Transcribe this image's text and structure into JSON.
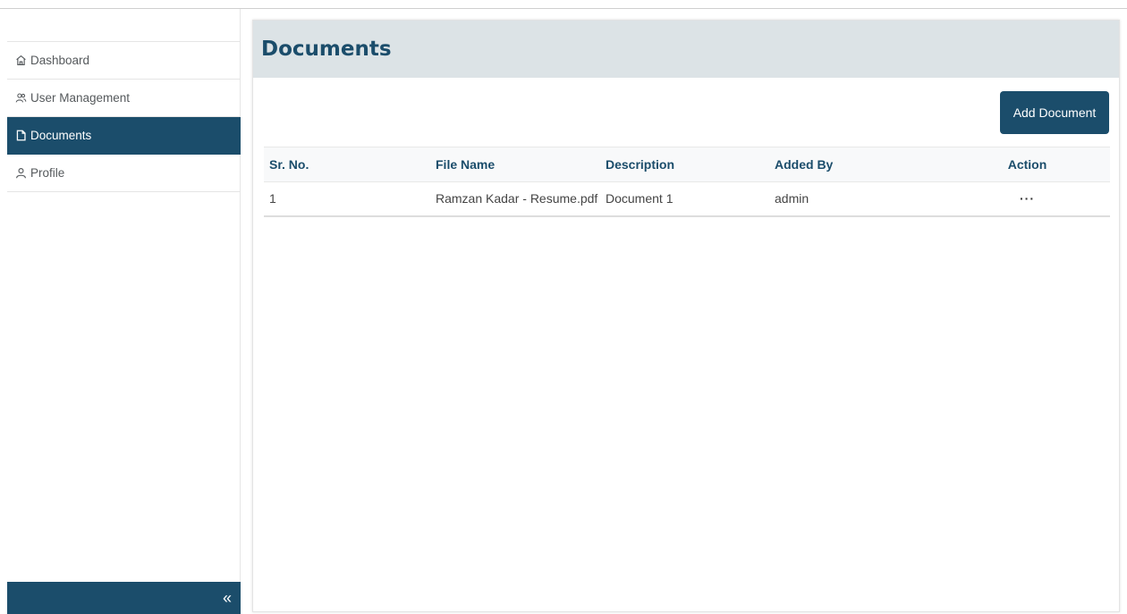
{
  "sidebar": {
    "items": [
      {
        "label": "Dashboard",
        "icon": "home-icon",
        "active": false
      },
      {
        "label": "User Management",
        "icon": "users-icon",
        "active": false
      },
      {
        "label": "Documents",
        "icon": "document-icon",
        "active": true
      },
      {
        "label": "Profile",
        "icon": "user-icon",
        "active": false
      }
    ],
    "collapse_label": "«"
  },
  "main": {
    "title": "Documents",
    "add_button_label": "Add Document",
    "table": {
      "headers": [
        "Sr. No.",
        "File Name",
        "Description",
        "Added By",
        "Action"
      ],
      "rows": [
        {
          "sr_no": "1",
          "file_name": "Ramzan Kadar - Resume.pdf",
          "description": "Document 1",
          "added_by": "admin",
          "action": "···"
        }
      ]
    }
  },
  "colors": {
    "primary": "#1b4d6b",
    "header_bg": "#dce3e6"
  }
}
